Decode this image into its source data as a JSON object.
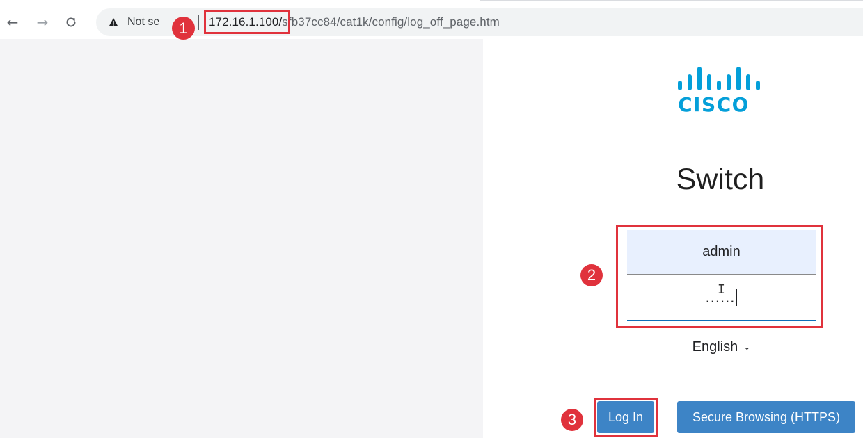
{
  "browser": {
    "security_label": "Not se",
    "url_host": "172.16.1.100/",
    "url_path": "sfb37cc84/cat1k/config/log_off_page.htm",
    "icons": [
      "back-arrow-icon",
      "forward-arrow-icon",
      "reload-icon",
      "warning-icon"
    ]
  },
  "page": {
    "logo_text": "CISCO",
    "title": "Switch",
    "username_value": "admin",
    "password_value": "......",
    "language_selected": "English",
    "login_label": "Log In",
    "https_label": "Secure Browsing (HTTPS)"
  },
  "annotations": {
    "step1": "1",
    "step2": "2",
    "step3": "3"
  },
  "colors": {
    "cisco_blue": "#049fd9",
    "button_blue": "#3d84c6",
    "annotation_red": "#e0323c",
    "autofill_bg": "#e8f0fe"
  }
}
